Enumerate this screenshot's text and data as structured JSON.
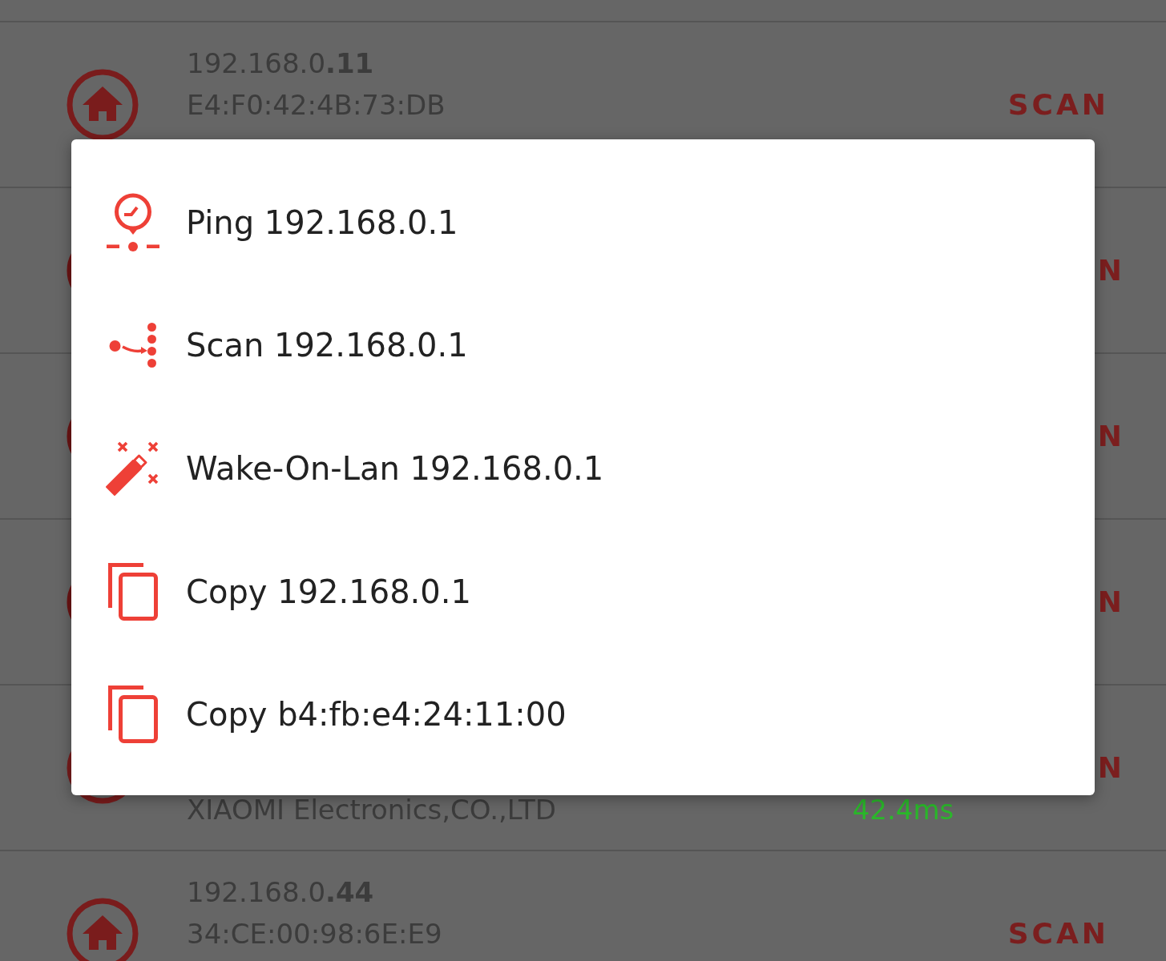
{
  "device_list": {
    "rows": [
      {
        "kind": "full",
        "ip": "192.168.0**.11**",
        "mac": "E4:F0:42:4B:73:DB",
        "action": "SCAN"
      },
      {
        "kind": "covered",
        "action": "N"
      },
      {
        "kind": "covered",
        "action": "N"
      },
      {
        "kind": "covered",
        "action": "N"
      },
      {
        "kind": "lower",
        "vendor": "XIAOMI Electronics,CO.,LTD",
        "latency": "42.4ms",
        "action": "N"
      },
      {
        "kind": "full",
        "ip": "192.168.0**.44**",
        "mac": "34:CE:00:98:6E:E9",
        "action": "SCAN"
      }
    ]
  },
  "menu": {
    "items": [
      {
        "kind": "ping",
        "label": "Ping 192.168.0.1"
      },
      {
        "kind": "scan",
        "label": "Scan 192.168.0.1"
      },
      {
        "kind": "wake",
        "label": "Wake-On-Lan 192.168.0.1"
      },
      {
        "kind": "copy",
        "label": "Copy 192.168.0.1"
      },
      {
        "kind": "copy",
        "label": "Copy b4:fb:e4:24:11:00"
      }
    ]
  }
}
